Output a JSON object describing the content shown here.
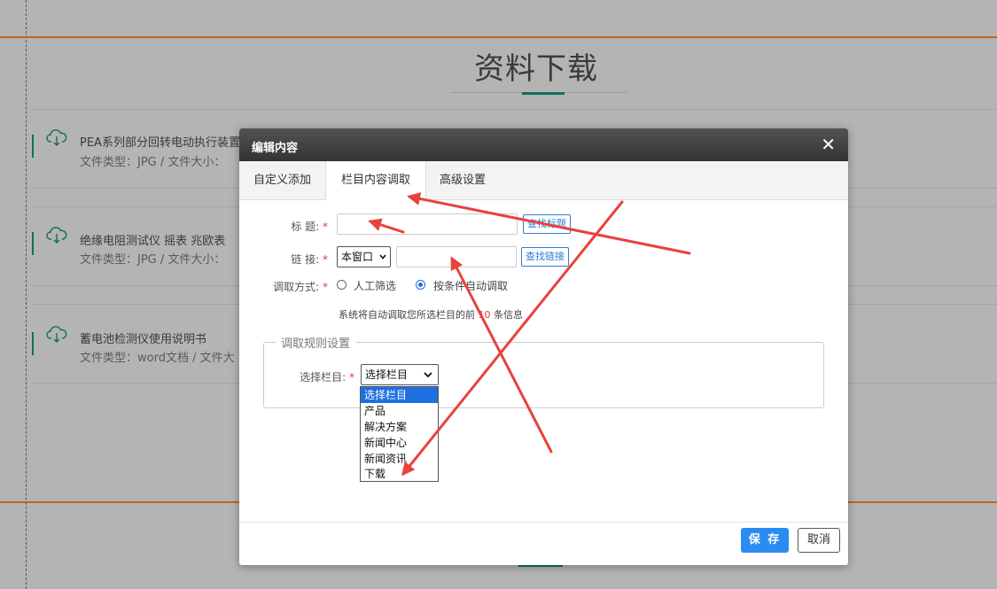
{
  "page": {
    "title": "资料下载",
    "items": [
      {
        "title": "PEA系列部分回转电动执行装置",
        "meta": "文件类型：JPG  /  文件大小："
      },
      {
        "title": "绝缘电阻测试仪 摇表 兆欧表",
        "meta": "文件类型：JPG  /  文件大小："
      },
      {
        "title": "蓄电池检测仪使用说明书",
        "meta": "文件类型：word文档  /  文件大"
      }
    ]
  },
  "modal": {
    "title": "编辑内容",
    "close": "✕",
    "tabs": [
      {
        "label": "自定义添加"
      },
      {
        "label": "栏目内容调取",
        "active": true
      },
      {
        "label": "高级设置"
      }
    ],
    "form": {
      "title_label": "标 题:",
      "required_mark": "*",
      "title_value": "",
      "find_title_button": "查找标题",
      "link_label": "链 接:",
      "link_target": "本窗口",
      "link_value": "",
      "find_link_button": "查找链接",
      "mode_label": "调取方式:",
      "mode_options": [
        {
          "label": "人工筛选",
          "checked": false
        },
        {
          "label": "按条件自动调取",
          "checked": true
        }
      ],
      "info_prefix": "系统将自动调取您所选栏目的前",
      "info_count": "10",
      "info_suffix": "条信息"
    },
    "rules": {
      "legend": "调取规则设置",
      "column_label": "选择栏目:",
      "column_selected": "选择栏目",
      "column_options": [
        "选择栏目",
        "产品",
        "解决方案",
        "新闻中心",
        "新闻资讯",
        "下载"
      ]
    },
    "buttons": {
      "save": "保 存",
      "cancel": "取消"
    }
  },
  "colors": {
    "accent": "#0f6f5b",
    "orange_line": "#c0651c",
    "primary": "#2a8cf0",
    "annotation": "#e8423c",
    "required": "#e4393c"
  }
}
